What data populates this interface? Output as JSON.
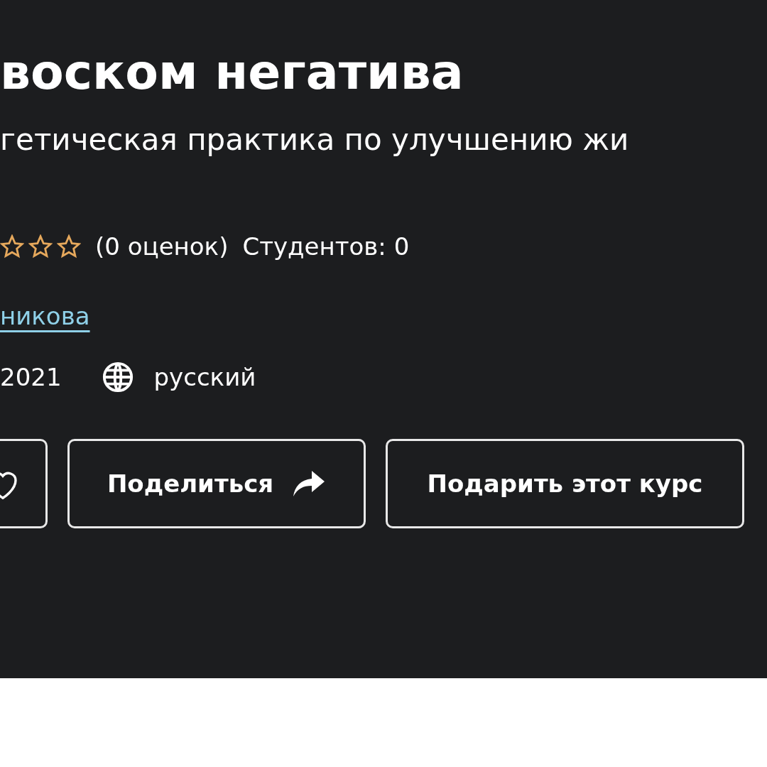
{
  "course": {
    "title": "воском негатива",
    "subtitle": "гетическая практика по улучшению жи",
    "rating": {
      "stars": 0,
      "count": "(0 оценок)",
      "students": "Студентов: 0"
    },
    "instructor_link": "никова",
    "updated": "2021",
    "language": "русский"
  },
  "buttons": [
    {
      "kind": "wishlist"
    },
    {
      "kind": "share",
      "label": "Поделиться"
    },
    {
      "kind": "gift",
      "label": "Подарить этот курс"
    }
  ]
}
